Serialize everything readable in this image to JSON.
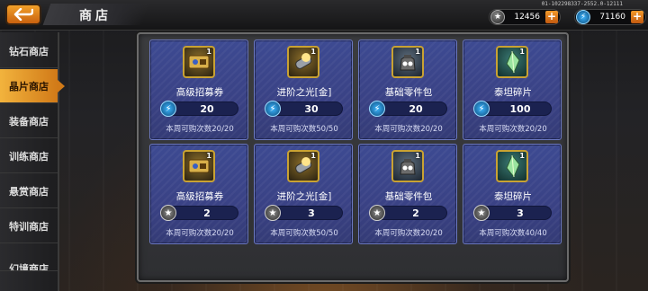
{
  "header": {
    "title": "商店",
    "build_info": "01-102298337-2552.0-12111",
    "currencies": [
      {
        "icon": "medal-icon",
        "value": "12456"
      },
      {
        "icon": "energy-icon",
        "value": "71160"
      }
    ]
  },
  "sidebar": {
    "items": [
      {
        "label": "钻石商店"
      },
      {
        "label": "晶片商店"
      },
      {
        "label": "装备商店"
      },
      {
        "label": "训练商店"
      },
      {
        "label": "悬赏商店"
      },
      {
        "label": "特训商店"
      },
      {
        "label": "幻境商店"
      }
    ],
    "active_index": 1
  },
  "shop": {
    "items": [
      {
        "name": "高级招募券",
        "qty": "1",
        "price": "20",
        "currency": "energy-icon",
        "limit": "本周可购次数20/20",
        "icon": "ticket-icon"
      },
      {
        "name": "进阶之光[金]",
        "qty": "1",
        "price": "30",
        "currency": "energy-icon",
        "limit": "本周可购次数50/50",
        "icon": "light-capsule-icon"
      },
      {
        "name": "基础零件包",
        "qty": "1",
        "price": "20",
        "currency": "energy-icon",
        "limit": "本周可购次数20/20",
        "icon": "parts-bag-icon"
      },
      {
        "name": "泰坦碎片",
        "qty": "1",
        "price": "100",
        "currency": "energy-icon",
        "limit": "本周可购次数20/20",
        "icon": "titan-shard-icon"
      },
      {
        "name": "高级招募券",
        "qty": "1",
        "price": "2",
        "currency": "medal-icon",
        "limit": "本周可购次数20/20",
        "icon": "ticket-icon"
      },
      {
        "name": "进阶之光[金]",
        "qty": "1",
        "price": "3",
        "currency": "medal-icon",
        "limit": "本周可购次数50/50",
        "icon": "light-capsule-icon"
      },
      {
        "name": "基础零件包",
        "qty": "1",
        "price": "2",
        "currency": "medal-icon",
        "limit": "本周可购次数20/20",
        "icon": "parts-bag-icon"
      },
      {
        "name": "泰坦碎片",
        "qty": "1",
        "price": "3",
        "currency": "medal-icon",
        "limit": "本周可购次数40/40",
        "icon": "titan-shard-icon"
      }
    ]
  },
  "colors": {
    "accent": "#e89a2a",
    "card_bg": "#3b4588",
    "energy": "#3db6ff"
  }
}
